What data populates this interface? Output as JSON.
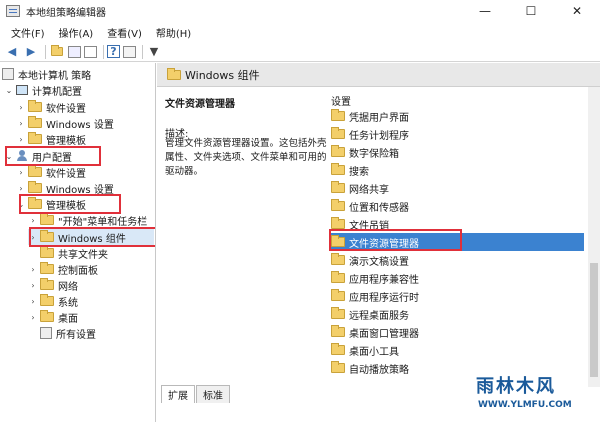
{
  "window": {
    "title": "本地组策略编辑器",
    "minimize": "—",
    "maximize": "☐",
    "close": "✕"
  },
  "menu": [
    "文件(F)",
    "操作(A)",
    "查看(V)",
    "帮助(H)"
  ],
  "tree": {
    "root": "本地计算机 策略",
    "computer_config": "计算机配置",
    "cc_software": "软件设置",
    "cc_windows": "Windows 设置",
    "cc_admin": "管理模板",
    "user_config": "用户配置",
    "uc_software": "软件设置",
    "uc_windows": "Windows 设置",
    "uc_admin": "管理模板",
    "start_menu": "\"开始\"菜单和任务栏",
    "windows_components": "Windows 组件",
    "shared_folders": "共享文件夹",
    "control_panel": "控制面板",
    "network": "网络",
    "system": "系统",
    "desktop": "桌面",
    "all_settings": "所有设置"
  },
  "right": {
    "header": "Windows 组件",
    "desc_title": "文件资源管理器",
    "desc_label": "描述:",
    "desc_body": "管理文件资源管理器设置。这包括外壳属性、文件夹选项、文件菜单和可用的驱动器。",
    "list_header": "设置",
    "items": [
      "凭据用户界面",
      "任务计划程序",
      "数字保险箱",
      "搜索",
      "网络共享",
      "位置和传感器",
      "文件吊销",
      "文件资源管理器",
      "演示文稿设置",
      "应用程序兼容性",
      "应用程序运行时",
      "远程桌面服务",
      "桌面窗口管理器",
      "桌面小工具",
      "自动播放策略"
    ],
    "tabs": [
      "扩展",
      "标准"
    ]
  },
  "watermark": {
    "title": "雨林木风",
    "url": "WWW.YLMFU.COM"
  },
  "colors": {
    "highlight": "#e0303a",
    "selected": "#3b82d0",
    "folder": "#f3cf6a"
  }
}
